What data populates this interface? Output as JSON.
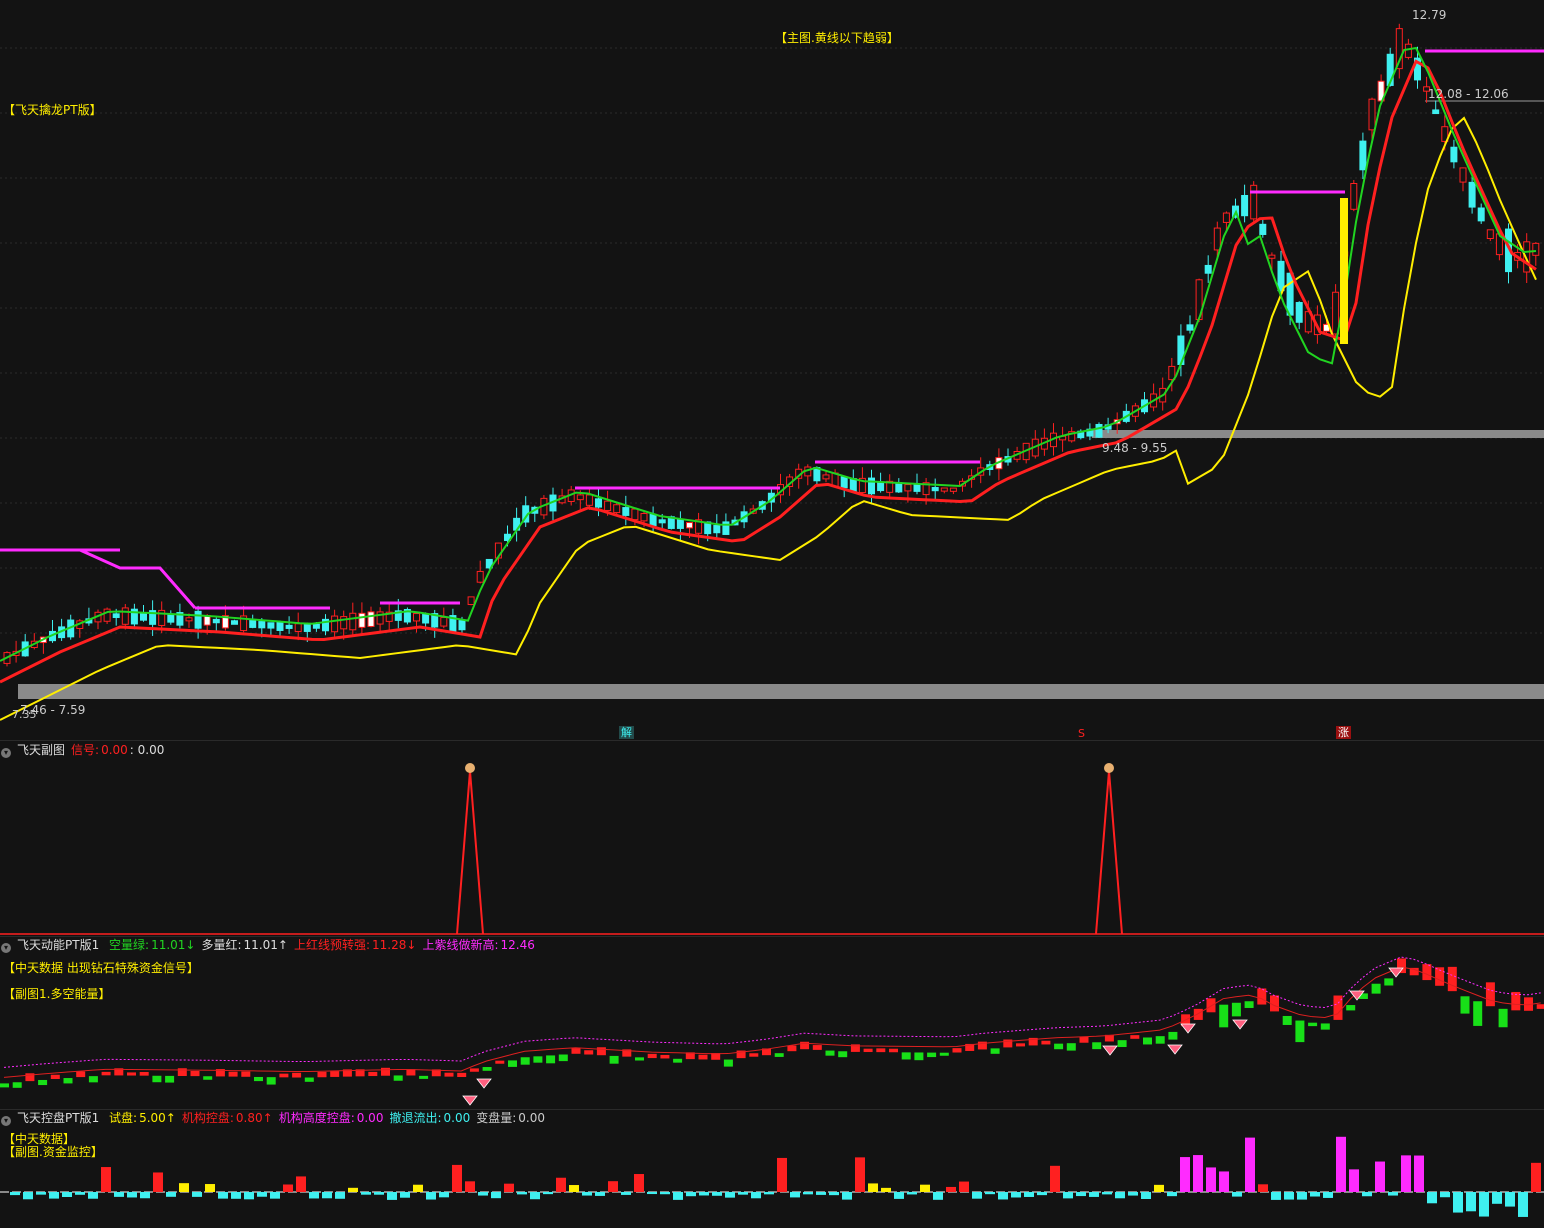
{
  "main": {
    "indicator_name": "【飞天擒龙PT版】",
    "hint": "【主图.黄线以下趋弱】",
    "price_high": "12.79",
    "range_upper": "12.08 - 12.06",
    "range_middle": "9.48 - 9.55",
    "range_lower": "7.46 - 7.59",
    "price_low": "7.35",
    "marker_jie": "解",
    "marker_s": "S",
    "marker_zhang": "涨"
  },
  "sub1": {
    "name": "飞天副图",
    "signal_label": "信号:",
    "signal_value": "0.00",
    "extra": ": 0.00"
  },
  "sub2": {
    "name": "飞天动能PT版1",
    "fields": [
      {
        "label": "空量绿:",
        "value": "11.01↓",
        "color": "#21d421"
      },
      {
        "label": "多量红:",
        "value": "11.01↑",
        "color": "#dddddd"
      },
      {
        "label": "上红线预转强:",
        "value": "11.28↓",
        "color": "#ff2020"
      },
      {
        "label": "上紫线做新高:",
        "value": "12.46",
        "color": "#ff2bff"
      }
    ],
    "note1": "【中天数据 出现钻石特殊资金信号】",
    "note2": "【副图1.多空能量】"
  },
  "sub3": {
    "name": "飞天控盘PT版1",
    "fields": [
      {
        "label": "试盘:",
        "value": "5.00↑",
        "color": "#ffee00"
      },
      {
        "label": "机构控盘:",
        "value": "0.80↑",
        "color": "#ff2020"
      },
      {
        "label": "机构高度控盘:",
        "value": "0.00",
        "color": "#ff2bff"
      },
      {
        "label": "撤退流出:",
        "value": "0.00",
        "color": "#3ff0f0"
      },
      {
        "label": "变盘量:",
        "value": "0.00",
        "color": "#cccccc"
      }
    ],
    "note1": "【中天数据】",
    "note2": "【副图.资金监控】"
  },
  "colors": {
    "up": "#ff2020",
    "down": "#3ff0f0",
    "yellow": "#ffee00",
    "magenta": "#ff2bff",
    "green": "#21d421",
    "background": "#131313"
  }
}
